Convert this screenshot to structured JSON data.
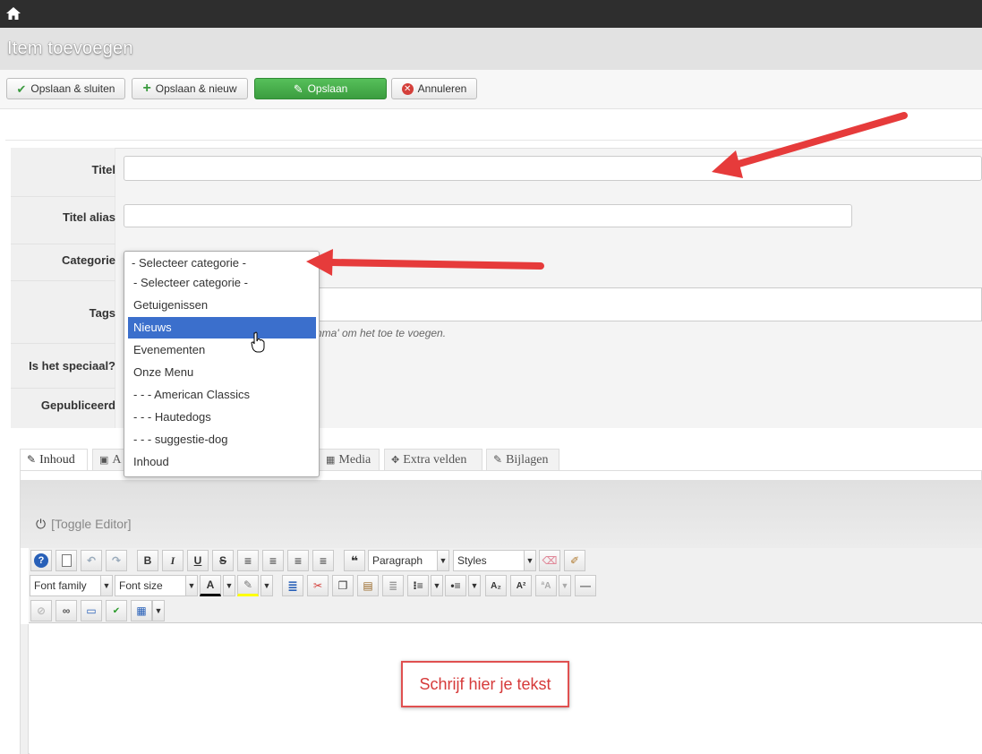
{
  "page": {
    "title": "Item toevoegen"
  },
  "toolbar": {
    "save_close": "Opslaan & sluiten",
    "save_new": "Opslaan & nieuw",
    "save": "Opslaan",
    "cancel": "Annuleren"
  },
  "form": {
    "title_label": "Titel",
    "title_value": "",
    "alias_label": "Titel alias",
    "alias_value": "",
    "category_label": "Categorie",
    "category_selected": "- Selecteer categorie -",
    "category_options": [
      "- Selecteer categorie -",
      "Getuigenissen",
      "Nieuws",
      "Evenementen",
      "Onze Menu",
      "- - - American Classics",
      "- - - Hautedogs",
      "- - - suggestie-dog",
      "Inhoud"
    ],
    "category_highlighted": "Nieuws",
    "tags_label": "Tags",
    "tags_hint": "omma' om het toe te voegen.",
    "special_label": "Is het speciaal?",
    "published_label": "Gepubliceerd"
  },
  "tabs": [
    {
      "label": "Inhoud",
      "icon": "edit-icon"
    },
    {
      "label": "A",
      "icon": "image-icon"
    },
    {
      "label": "Media",
      "icon": "film-icon"
    },
    {
      "label": "Extra velden",
      "icon": "puzzle-icon"
    },
    {
      "label": "Bijlagen",
      "icon": "paperclip-icon"
    }
  ],
  "editor": {
    "toggle_label": "[Toggle Editor]",
    "paragraph_select": "Paragraph",
    "styles_select": "Styles",
    "font_family_select": "Font family",
    "font_size_select": "Font size",
    "callout_text": "Schrijf hier je tekst"
  },
  "colors": {
    "topbar": "#2e2e2e",
    "save_green": "#46a84a",
    "selected_option": "#3b6fcc",
    "arrow_red": "#e63b3b"
  }
}
